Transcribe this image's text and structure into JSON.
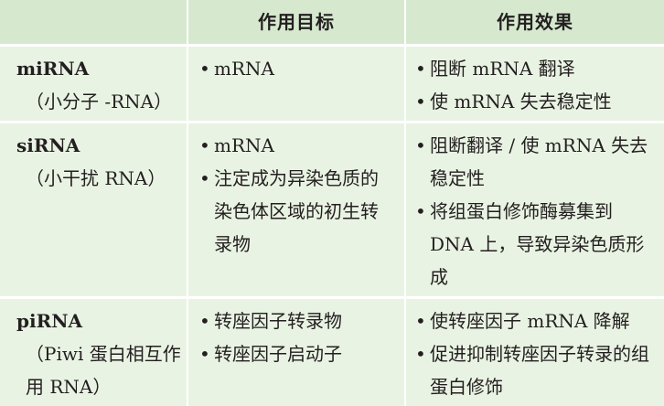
{
  "header": {
    "col1": "",
    "col2": "作用目标",
    "col3": "作用效果"
  },
  "rows": [
    {
      "name": "miRNA",
      "note": "（小分子 -RNA）",
      "targets": [
        "mRNA"
      ],
      "effects": [
        "阻断 mRNA 翻译",
        "使 mRNA 失去稳定性"
      ]
    },
    {
      "name": "siRNA",
      "note": "（小干扰 RNA）",
      "targets": [
        "mRNA",
        "注定成为异染色质的染色体区域的初生转录物"
      ],
      "effects": [
        "阻断翻译 / 使 mRNA 失去稳定性",
        "将组蛋白修饰酶募集到 DNA 上，导致异染色质形成"
      ]
    },
    {
      "name": "piRNA",
      "note": "（Piwi 蛋白相互作用 RNA）",
      "targets": [
        "转座因子转录物",
        "转座因子启动子"
      ],
      "effects": [
        "使转座因子 mRNA 降解",
        "促进抑制转座因子转录的组蛋白修饰"
      ]
    }
  ],
  "colors": {
    "header_bg": "#d6e9cf",
    "row_bg": "#e9f3e3",
    "separator": "#ffffff",
    "text": "#231f20"
  }
}
